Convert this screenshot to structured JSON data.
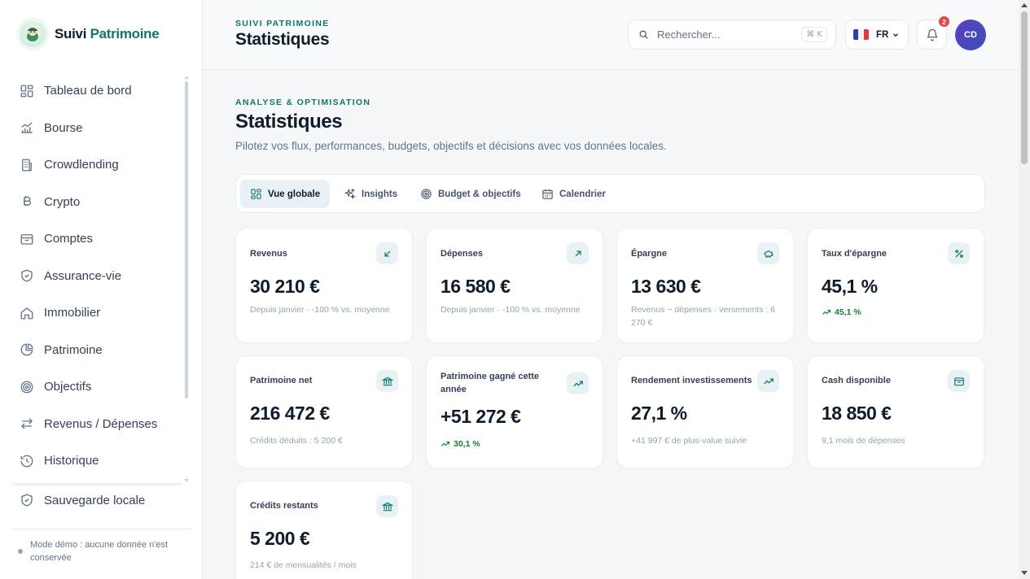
{
  "brand": {
    "name_part1": "Suivi",
    "name_part2": "Patrimoine"
  },
  "sidebar": {
    "items": [
      {
        "label": "Tableau de bord",
        "icon": "dashboard-icon"
      },
      {
        "label": "Bourse",
        "icon": "stock-chart-icon"
      },
      {
        "label": "Crowdlending",
        "icon": "building-icon"
      },
      {
        "label": "Crypto",
        "icon": "bitcoin-icon"
      },
      {
        "label": "Comptes",
        "icon": "wallet-icon"
      },
      {
        "label": "Assurance-vie",
        "icon": "shield-icon"
      },
      {
        "label": "Immobilier",
        "icon": "home-icon"
      },
      {
        "label": "Patrimoine",
        "icon": "pie-chart-icon"
      },
      {
        "label": "Objectifs",
        "icon": "target-icon"
      },
      {
        "label": "Revenus / Dépenses",
        "icon": "arrows-icon"
      },
      {
        "label": "Historique",
        "icon": "history-icon"
      }
    ],
    "backup_label": "Sauvegarde locale",
    "demo_note": "Mode démo : aucune donnée n'est conservée"
  },
  "header": {
    "eyebrow": "SUIVI PATRIMOINE",
    "title": "Statistiques",
    "search_placeholder": "Rechercher...",
    "search_shortcut": "⌘ K",
    "language": "FR",
    "notifications_count": "2",
    "avatar_initials": "CD"
  },
  "page": {
    "eyebrow": "ANALYSE & OPTIMISATION",
    "title": "Statistiques",
    "subtitle": "Pilotez vos flux, performances, budgets, objectifs et décisions avec vos données locales."
  },
  "tabs": [
    {
      "label": "Vue globale",
      "active": true
    },
    {
      "label": "Insights",
      "active": false
    },
    {
      "label": "Budget & objectifs",
      "active": false
    },
    {
      "label": "Calendrier",
      "active": false
    }
  ],
  "cards": [
    {
      "label": "Revenus",
      "value": "30 210 €",
      "sub": "Depuis janvier · -100 % vs. moyenne",
      "icon": "arrow-down-left-icon"
    },
    {
      "label": "Dépenses",
      "value": "16 580 €",
      "sub": "Depuis janvier · -100 % vs. moyenne",
      "icon": "arrow-up-right-icon"
    },
    {
      "label": "Épargne",
      "value": "13 630 €",
      "sub": "Revenus − dépenses · versements : 6 270 €",
      "icon": "piggy-bank-icon"
    },
    {
      "label": "Taux d'épargne",
      "value": "45,1 %",
      "trend": "45,1 %",
      "icon": "percent-icon"
    },
    {
      "label": "Patrimoine net",
      "value": "216 472 €",
      "sub": "Crédits déduits : 5 200 €",
      "icon": "bank-icon"
    },
    {
      "label": "Patrimoine gagné cette année",
      "value": "+51 272 €",
      "trend": "30,1 %",
      "icon": "trending-up-icon"
    },
    {
      "label": "Rendement investissements",
      "value": "27,1 %",
      "sub": "+41 997 € de plus-value suivie",
      "icon": "trending-up-icon"
    },
    {
      "label": "Cash disponible",
      "value": "18 850 €",
      "sub": "9,1 mois de dépenses",
      "icon": "wallet-icon"
    },
    {
      "label": "Crédits restants",
      "value": "5 200 €",
      "sub": "214 € de mensualités / mois",
      "icon": "bank-icon"
    }
  ],
  "colors": {
    "accent": "#0f766e",
    "positive": "#15803d",
    "badge": "#e54848",
    "avatar": "#4b44c0"
  }
}
